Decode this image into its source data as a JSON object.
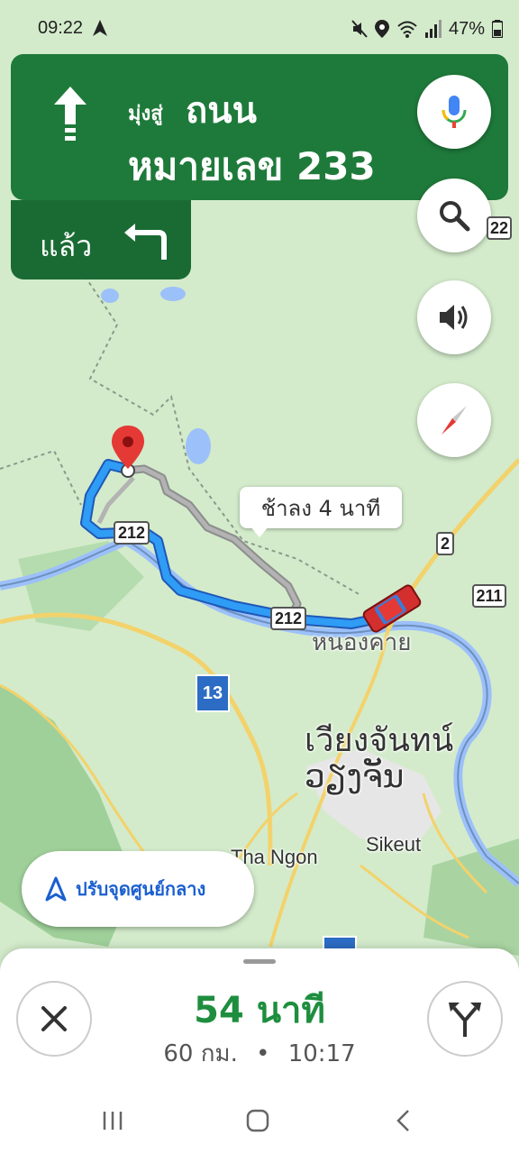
{
  "status_bar": {
    "time": "09:22",
    "battery": "47%"
  },
  "navigation": {
    "prefix": "มุ่งสู่",
    "street_line1": "ถนน",
    "street_line2": "หมายเลข 233",
    "then_label": "แล้ว"
  },
  "map": {
    "route_callout": "ช้าลง 4 นาที",
    "shields": {
      "r212_a": "212",
      "r212_b": "212",
      "r2": "2",
      "r211": "211",
      "r22": "22",
      "r13": "13"
    },
    "labels": {
      "nong_khai": "หนองคาย",
      "vientiane_th": "เวียงจันทน์",
      "vientiane_lo": "ວຽງຈັນ",
      "tha_ngon": "Tha Ngon",
      "sikeut": "Sikeut"
    }
  },
  "recenter": {
    "label": "ปรับจุดศูนย์กลาง"
  },
  "trip": {
    "duration": "54 นาที",
    "distance": "60 กม.",
    "separator": "•",
    "arrival": "10:17"
  },
  "colors": {
    "banner_green": "#1e7a3a",
    "route_blue": "#2f6fdc",
    "eta_green": "#1e8e3e",
    "recenter_blue": "#1a5fd0"
  }
}
